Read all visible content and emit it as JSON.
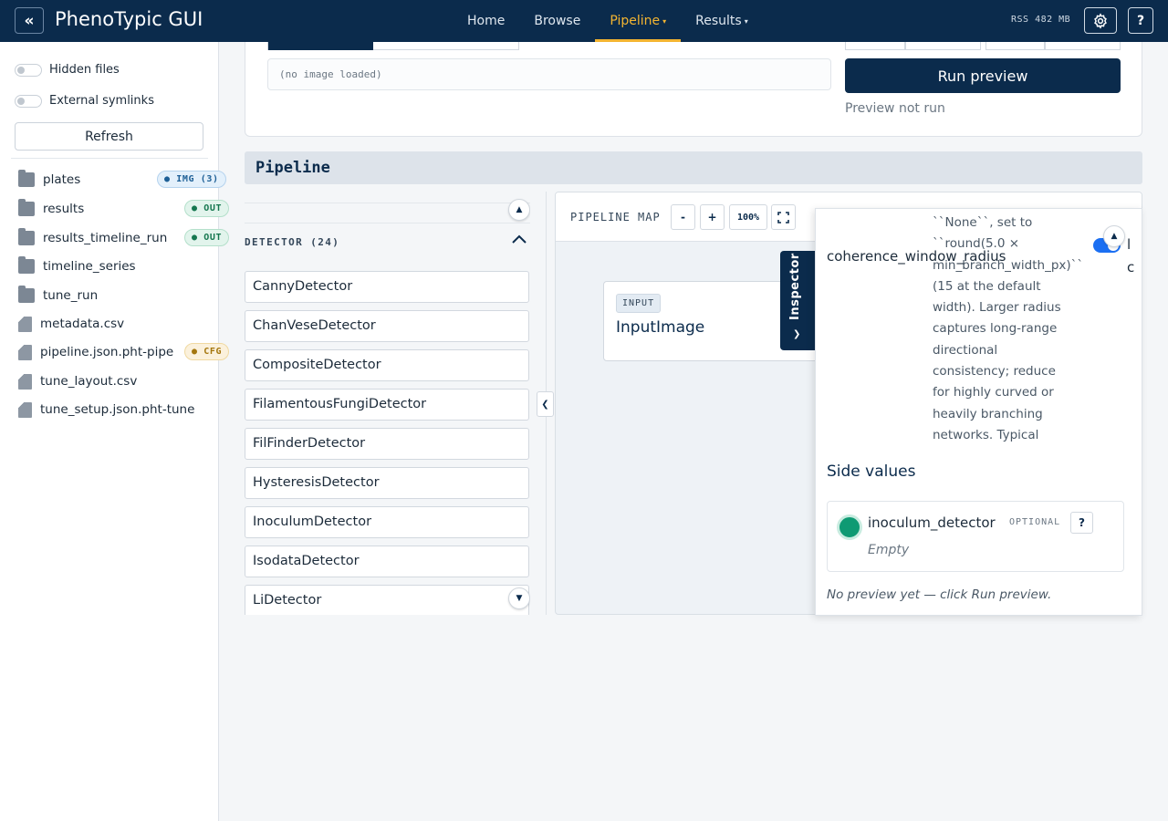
{
  "header": {
    "collapse_icon": "«",
    "title": "PhenoTypic GUI",
    "nav": [
      {
        "label": "Home"
      },
      {
        "label": "Browse"
      },
      {
        "label": "Pipeline",
        "caret": "▾",
        "active": true
      },
      {
        "label": "Results",
        "caret": "▾"
      }
    ],
    "memory": "RSS 482 MB",
    "settings_icon": "gear-icon",
    "help_label": "?"
  },
  "sidebar": {
    "toggles": [
      {
        "label": "Hidden files",
        "on": false
      },
      {
        "label": "External symlinks",
        "on": false
      }
    ],
    "refresh_label": "Refresh",
    "files": [
      {
        "name": "plates",
        "type": "folder",
        "badge": "IMG (3)"
      },
      {
        "name": "results",
        "type": "folder",
        "badge": "OUT"
      },
      {
        "name": "results_timeline_run",
        "type": "folder",
        "badge": "OUT"
      },
      {
        "name": "timeline_series",
        "type": "folder"
      },
      {
        "name": "tune_run",
        "type": "folder"
      },
      {
        "name": "metadata.csv",
        "type": "file"
      },
      {
        "name": "pipeline.json.pht-pipe",
        "type": "file",
        "badge": "CFG"
      },
      {
        "name": "tune_layout.csv",
        "type": "file"
      },
      {
        "name": "tune_setup.json.pht-tune",
        "type": "file"
      }
    ]
  },
  "preview": {
    "image_status": "(no image loaded)",
    "run_label": "Run preview",
    "status": "Preview not run"
  },
  "pipeline": {
    "header": "Pipeline",
    "palette": {
      "group_title": "DETECTOR (24)",
      "detectors": [
        "CannyDetector",
        "ChanVeseDetector",
        "CompositeDetector",
        "FilamentousFungiDetector",
        "FilFinderDetector",
        "HysteresisDetector",
        "InoculumDetector",
        "IsodataDetector",
        "LiDetector"
      ]
    },
    "map": {
      "title": "PIPELINE MAP",
      "zoom_out": "-",
      "zoom_in": "+",
      "zoom_level": "100%",
      "fullscreen_icon": "fullscreen-icon",
      "node": {
        "tag": "INPUT",
        "name": "InputImage"
      }
    },
    "inspector": {
      "tab_label": "Inspector",
      "param_name": "coherence_window_radius",
      "param_desc_lines": [
        "``None``, set to",
        "``round(5.0 ×",
        "min_branch_width_px)``",
        "(15 at the default",
        "width). Larger radius",
        "captures long-range",
        "directional",
        "consistency; reduce",
        "for highly curved or",
        "heavily branching",
        "networks. Typical"
      ],
      "side_values_title": "Side values",
      "side_value": {
        "name": "inoculum_detector",
        "optional": "OPTIONAL",
        "help": "?",
        "value": "Empty"
      },
      "note": "No preview yet — click Run preview."
    }
  },
  "colors": {
    "brand": "#0b2b4c",
    "accent": "#f4b531",
    "toggle_on": "#1b6ff2",
    "side_dot": "#0e9a73"
  }
}
